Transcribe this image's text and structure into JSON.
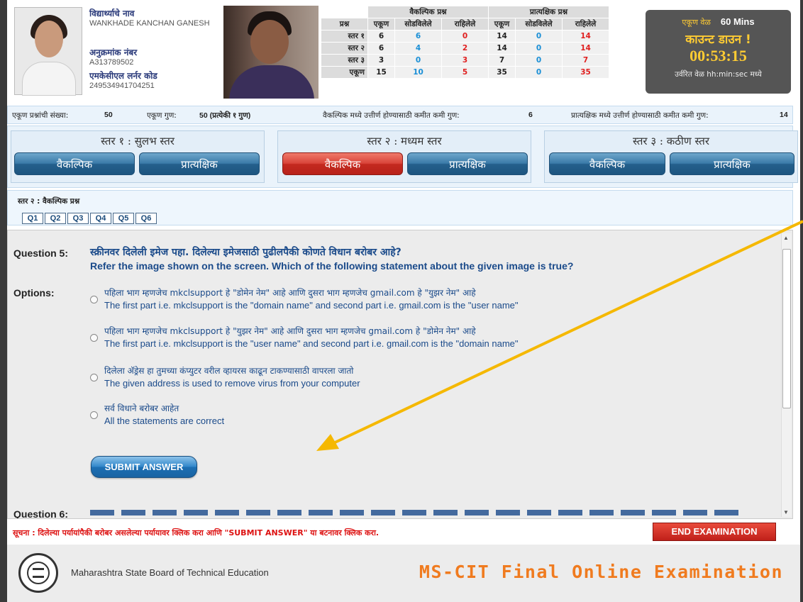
{
  "student": {
    "name_label": "विद्यार्थ्याचे नाव",
    "name": "WANKHADE KANCHAN GANESH",
    "roll_label": "अनुक्रमांक नंबर",
    "roll": "A313789502",
    "code_label": "एमकेसीएल लर्नर कोड",
    "code": "249534941704251"
  },
  "stats": {
    "group_mcq": "वैकल्पिक प्रश्न",
    "group_practical": "प्रात्यक्षिक प्रश्न",
    "col_q": "प्रश्न",
    "col_total": "एकूण",
    "col_solved": "सोडविलेले",
    "col_remaining": "राहिलेले",
    "rows": [
      {
        "label": "स्तर १",
        "m_total": "6",
        "m_solved": "6",
        "m_rem": "0",
        "p_total": "14",
        "p_solved": "0",
        "p_rem": "14"
      },
      {
        "label": "स्तर २",
        "m_total": "6",
        "m_solved": "4",
        "m_rem": "2",
        "p_total": "14",
        "p_solved": "0",
        "p_rem": "14"
      },
      {
        "label": "स्तर ३",
        "m_total": "3",
        "m_solved": "0",
        "m_rem": "3",
        "p_total": "7",
        "p_solved": "0",
        "p_rem": "7"
      },
      {
        "label": "एकूण",
        "m_total": "15",
        "m_solved": "10",
        "m_rem": "5",
        "p_total": "35",
        "p_solved": "0",
        "p_rem": "35"
      }
    ]
  },
  "timer": {
    "total_label": "एकूण वेळ",
    "total": "60 Mins",
    "countdown_label": "काउन्ट डाउन !",
    "remaining": "00:53:15",
    "note": "उर्वरित वेळ hh:min:sec मध्ये"
  },
  "summary": {
    "total_q_label": "एकूण प्रश्नांची संख्या:",
    "total_q": "50",
    "total_marks_label": "एकूण गुण:",
    "total_marks": "50 (प्रत्येकी १ गुण)",
    "mcq_pass_label": "वैकल्पिक मध्ये उत्तीर्ण होण्यासाठी कमीत कमी गुण:",
    "mcq_pass": "6",
    "prac_pass_label": "प्रात्यक्षिक मध्ये उत्तीर्ण होण्यासाठी कमीत कमी गुण:",
    "prac_pass": "14"
  },
  "levels": [
    {
      "title": "स्तर १ : सुलभ स्तर",
      "mcq": "वैकल्पिक",
      "practical": "प्रात्यक्षिक"
    },
    {
      "title": "स्तर २ : मध्यम स्तर",
      "mcq": "वैकल्पिक",
      "practical": "प्रात्यक्षिक"
    },
    {
      "title": "स्तर ३ : कठीण स्तर",
      "mcq": "वैकल्पिक",
      "practical": "प्रात्यक्षिक"
    }
  ],
  "qnav": {
    "caption": "स्तर २ : वैकल्पिक प्रश्न",
    "buttons": [
      "Q1",
      "Q2",
      "Q3",
      "Q4",
      "Q5",
      "Q6"
    ]
  },
  "question": {
    "label": "Question 5:",
    "text_mr": "स्क्रीनवर दिलेली इमेज पहा. दिलेल्या इमेजसाठी पुढीलपैकी कोणते विधान बरोबर आहे?",
    "text_en": "Refer the image shown on the screen. Which of the following statement about the given image is true?",
    "options_label": "Options:",
    "options": [
      {
        "mr": "पहिला भाग म्हणजेच mkclsupport हे \"डोमेन नेम\" आहे आणि दुसरा भाग म्हणजेच gmail.com हे \"युझर नेम\" आहे",
        "en": "The first part i.e. mkclsupport is the \"domain name\" and second part i.e. gmail.com is the \"user name\""
      },
      {
        "mr": "पहिला भाग म्हणजेच mkclsupport हे \"युझर नेम\" आहे आणि दुसरा भाग म्हणजेच gmail.com हे \"डोमेन नेम\" आहे",
        "en": "The first part i.e. mkclsupport is the \"user name\" and second part i.e. gmail.com is the \"domain name\""
      },
      {
        "mr": "दिलेला अ‍ॅड्रेस हा तुमच्या कंप्युटर वरील व्हायरस काढून टाकण्यासाठी वापरला जातो",
        "en": "The given address is used to remove virus from your computer"
      },
      {
        "mr": "सर्व विधाने बरोबर आहेत",
        "en": "All the statements are correct"
      }
    ],
    "submit": "SUBMIT ANSWER",
    "next_label": "Question 6:"
  },
  "notice": "सूचना : दिलेल्या पर्यायांपैकी बरोबर असलेल्या पर्यायावर क्लिक करा आणि \"SUBMIT ANSWER\" या बटनावर क्लिक करा.",
  "end_exam": "END EXAMINATION",
  "footer": {
    "board": "Maharashtra State Board of Technical Education",
    "brand": "MS-CIT Final Online Examination"
  },
  "colors": {
    "accent_blue": "#2f86c9",
    "active_red": "#d9443a",
    "brand_orange": "#f07b1f",
    "arrow": "#f5b800"
  }
}
